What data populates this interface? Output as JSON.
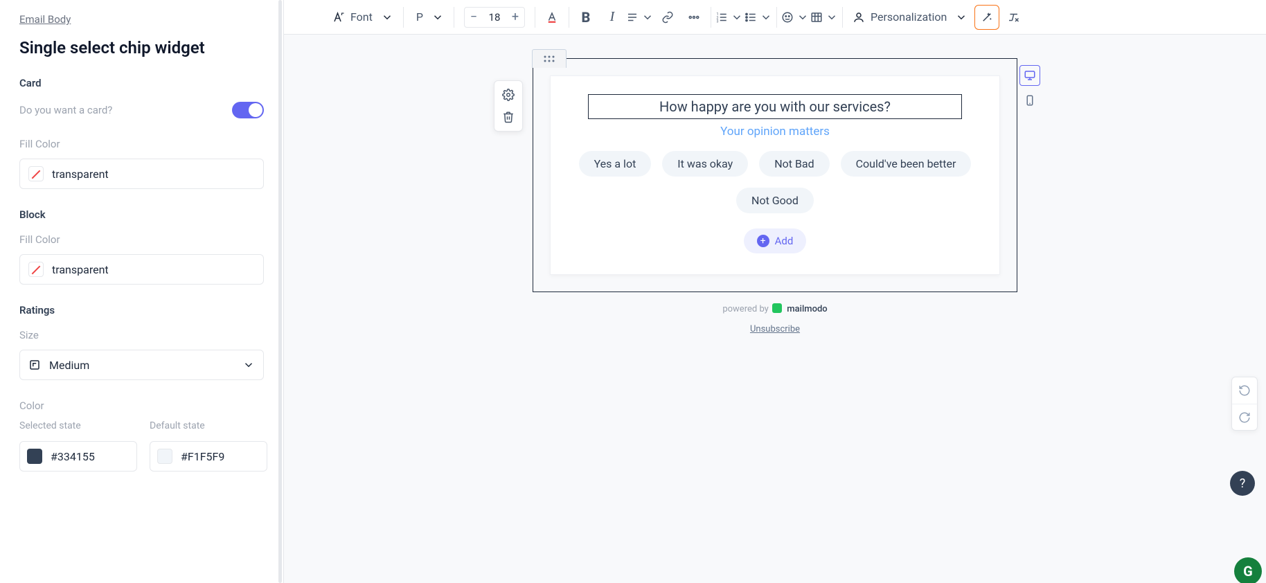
{
  "sidebar": {
    "breadcrumb": "Email Body",
    "title": "Single select chip widget",
    "card": {
      "section": "Card",
      "toggle_label": "Do you want a card?",
      "fill_label": "Fill Color",
      "fill_value": "transparent"
    },
    "block": {
      "section": "Block",
      "fill_label": "Fill Color",
      "fill_value": "transparent"
    },
    "ratings": {
      "section": "Ratings",
      "size_label": "Size",
      "size_value": "Medium",
      "color_label": "Color",
      "selected_label": "Selected state",
      "selected_hex": "#334155",
      "default_label": "Default state",
      "default_hex": "#F1F5F9"
    }
  },
  "toolbar": {
    "font_label": "Font",
    "paragraph_tag": "P",
    "font_size": "18",
    "personalization": "Personalization"
  },
  "canvas": {
    "question": "How happy are you with our services?",
    "subtitle": "Your opinion matters",
    "chips": [
      "Yes a lot",
      "It was okay",
      "Not Bad",
      "Could've been better",
      "Not Good"
    ],
    "add_label": "Add",
    "powered_prefix": "powered by",
    "brand": "mailmodo",
    "unsubscribe": "Unsubscribe"
  }
}
